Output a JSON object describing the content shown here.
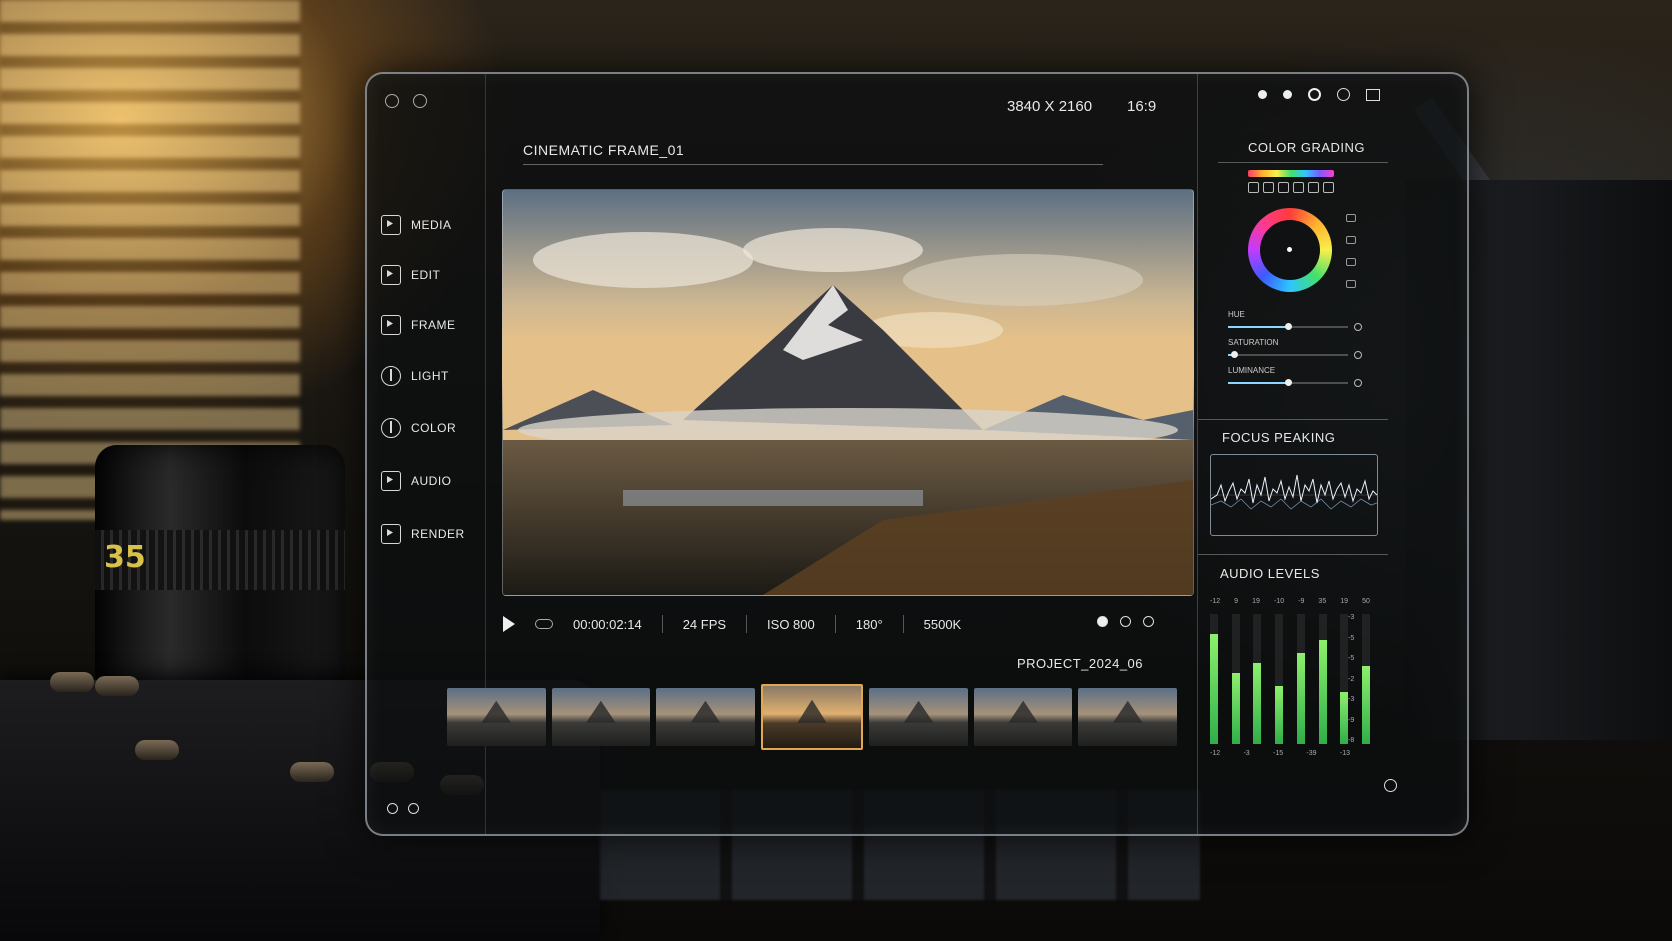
{
  "window": {
    "title": "CINEMATIC FRAME_01",
    "resolution": "3840 X 2160",
    "aspect": "16:9"
  },
  "sidebar": {
    "items": [
      {
        "label": "MEDIA",
        "icon": "media-icon"
      },
      {
        "label": "EDIT",
        "icon": "edit-icon"
      },
      {
        "label": "FRAME",
        "icon": "frame-icon"
      },
      {
        "label": "LIGHT",
        "icon": "light-icon"
      },
      {
        "label": "COLOR",
        "icon": "color-icon"
      },
      {
        "label": "AUDIO",
        "icon": "audio-icon"
      },
      {
        "label": "RENDER",
        "icon": "render-icon"
      }
    ]
  },
  "transport": {
    "timecode": "00:00:02:14",
    "fps": "24 FPS",
    "iso": "ISO 800",
    "shutter": "180°",
    "white_balance": "5500K"
  },
  "project": {
    "name": "PROJECT_2024_06"
  },
  "filmstrip": {
    "count": 7,
    "selected": 3
  },
  "color_grading": {
    "title": "COLOR GRADING",
    "sliders": [
      {
        "label": "HUE",
        "value": 0.5
      },
      {
        "label": "SATURATION",
        "value": 0.05
      },
      {
        "label": "LUMINANCE",
        "value": 0.5
      }
    ]
  },
  "focus_peaking": {
    "title": "FOCUS PEAKING"
  },
  "audio_levels": {
    "title": "AUDIO LEVELS",
    "top_ticks": [
      "-12",
      "9",
      "19",
      "-10",
      "-9",
      "35",
      "19",
      "50"
    ],
    "bottom_ticks": [
      "-12",
      "-3",
      "-15",
      "-39",
      "-13"
    ],
    "right_scale": [
      "-3",
      "-5",
      "-5",
      "-2",
      "-3",
      "-9",
      "-8"
    ],
    "levels": [
      0.85,
      0.55,
      0.62,
      0.45,
      0.7,
      0.8,
      0.4,
      0.6
    ]
  },
  "colors": {
    "accent": "#e2a850",
    "meter": "#8ef06c"
  }
}
